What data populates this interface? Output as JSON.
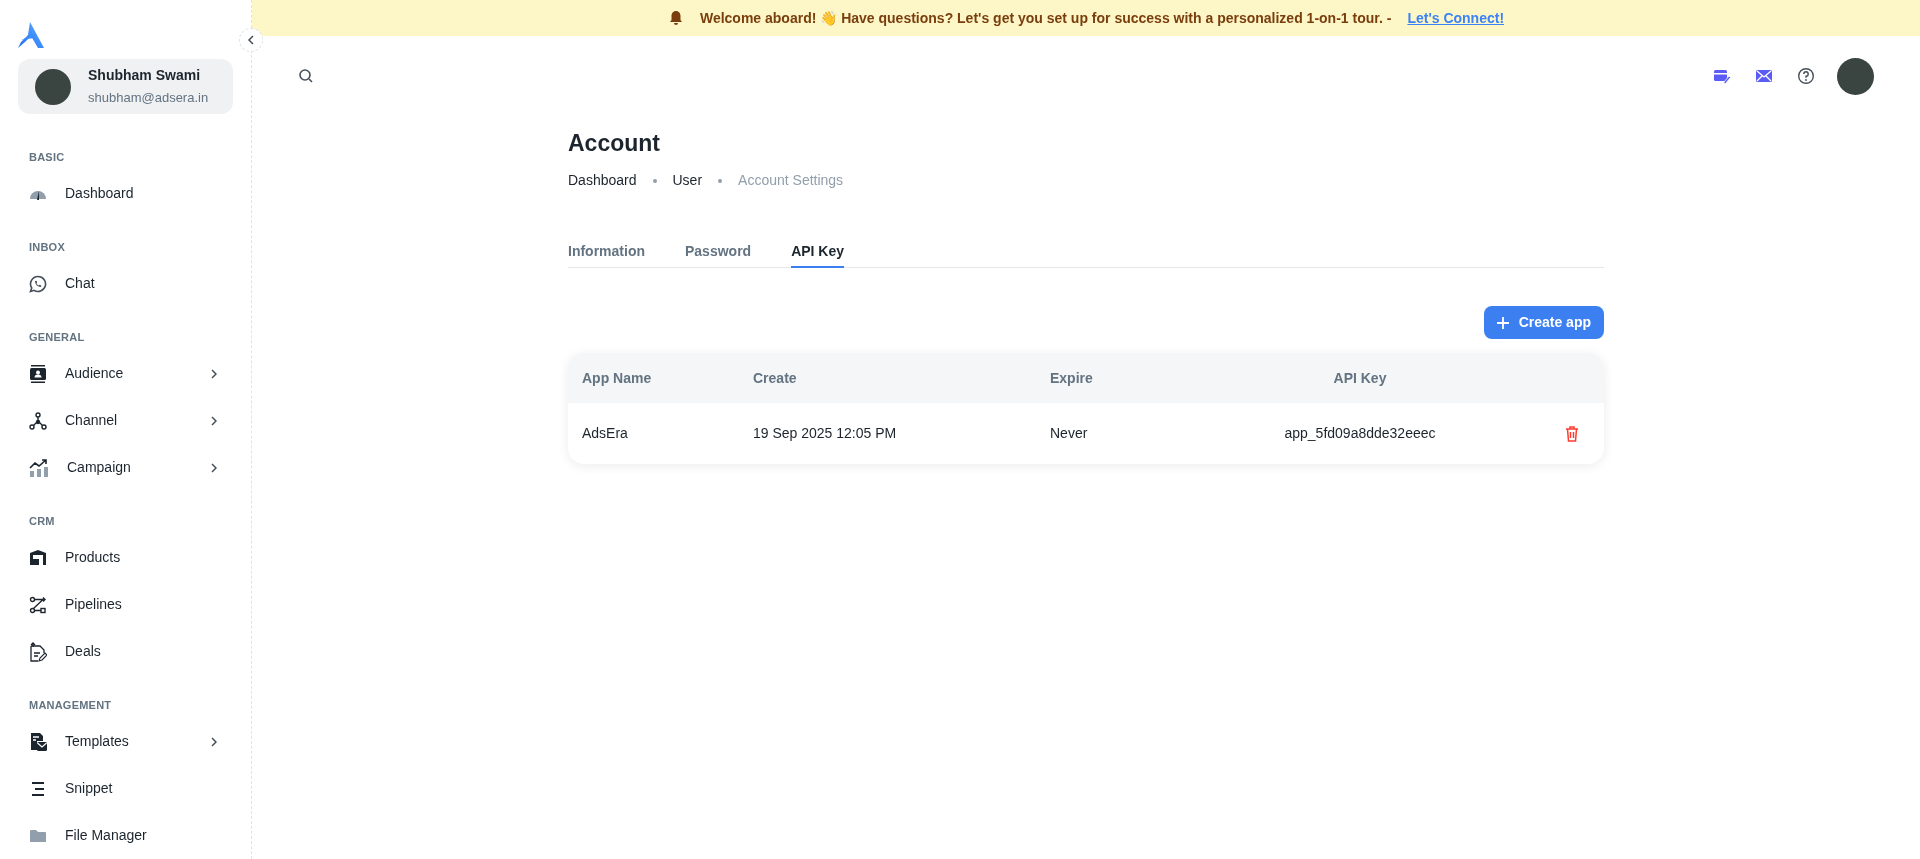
{
  "banner": {
    "message": "Welcome aboard! 👋 Have questions? Let's get you set up for success with a personalized 1-on-1 tour. -",
    "link": "Let's Connect!"
  },
  "sidebar": {
    "user": {
      "name": "Shubham Swami",
      "email": "shubham@adsera.in"
    },
    "sections": [
      {
        "title": "BASIC",
        "items": [
          {
            "label": "Dashboard",
            "has_submenu": false
          }
        ]
      },
      {
        "title": "INBOX",
        "items": [
          {
            "label": "Chat",
            "has_submenu": false
          }
        ]
      },
      {
        "title": "GENERAL",
        "items": [
          {
            "label": "Audience",
            "has_submenu": true
          },
          {
            "label": "Channel",
            "has_submenu": true
          },
          {
            "label": "Campaign",
            "has_submenu": true
          }
        ]
      },
      {
        "title": "CRM",
        "items": [
          {
            "label": "Products",
            "has_submenu": false
          },
          {
            "label": "Pipelines",
            "has_submenu": false
          },
          {
            "label": "Deals",
            "has_submenu": false
          }
        ]
      },
      {
        "title": "MANAGEMENT",
        "items": [
          {
            "label": "Templates",
            "has_submenu": true
          },
          {
            "label": "Snippet",
            "has_submenu": false
          },
          {
            "label": "File Manager",
            "has_submenu": false
          }
        ]
      }
    ]
  },
  "page": {
    "title": "Account",
    "breadcrumbs": [
      "Dashboard",
      "User",
      "Account Settings"
    ],
    "tabs": [
      {
        "label": "Information",
        "selected": false
      },
      {
        "label": "Password",
        "selected": false
      },
      {
        "label": "API Key",
        "selected": true
      }
    ],
    "create_button": "Create app",
    "table": {
      "columns": [
        "App Name",
        "Create",
        "Expire",
        "API Key"
      ],
      "rows": [
        {
          "cells": [
            "AdsEra",
            "19 Sep 2025 12:05 PM",
            "Never",
            "app_5fd09a8dde32eeec"
          ]
        }
      ]
    }
  }
}
